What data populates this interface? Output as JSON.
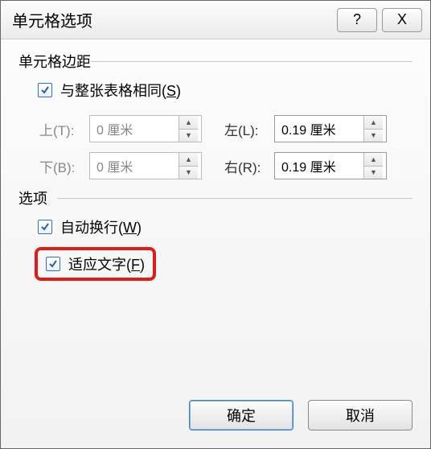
{
  "title": "单元格选项",
  "titlebar": {
    "help_glyph": "?",
    "close_glyph": "X"
  },
  "sections": {
    "margins": {
      "legend": "单元格边距",
      "same_as_table": {
        "label": "与整张表格相同(",
        "accel": "S",
        "suffix": ")"
      },
      "top": {
        "label": "上(T):",
        "value": "0 厘米"
      },
      "left": {
        "label": "左(L):",
        "value": "0.19 厘米"
      },
      "bottom": {
        "label": "下(B):",
        "value": "0 厘米"
      },
      "right": {
        "label": "右(R):",
        "value": "0.19 厘米"
      }
    },
    "options": {
      "legend": "选项",
      "wrap": {
        "label": "自动换行(",
        "accel": "W",
        "suffix": ")"
      },
      "fit": {
        "label": "适应文字(",
        "accel": "F",
        "suffix": ")"
      }
    }
  },
  "buttons": {
    "ok": "确定",
    "cancel": "取消"
  }
}
